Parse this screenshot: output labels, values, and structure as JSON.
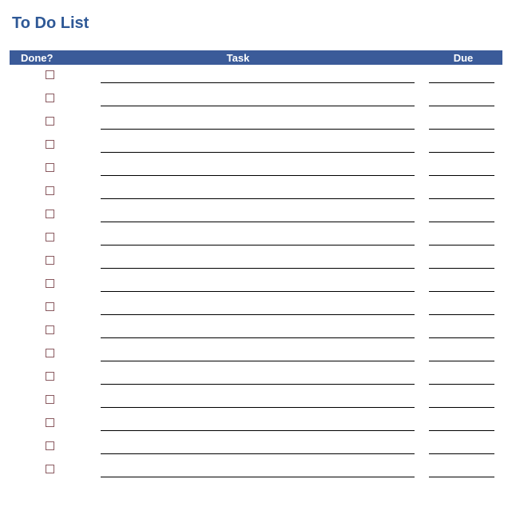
{
  "title": "To Do List",
  "columns": {
    "done": "Done?",
    "task": "Task",
    "due": "Due"
  },
  "rows": [
    {
      "done": false,
      "task": "",
      "due": ""
    },
    {
      "done": false,
      "task": "",
      "due": ""
    },
    {
      "done": false,
      "task": "",
      "due": ""
    },
    {
      "done": false,
      "task": "",
      "due": ""
    },
    {
      "done": false,
      "task": "",
      "due": ""
    },
    {
      "done": false,
      "task": "",
      "due": ""
    },
    {
      "done": false,
      "task": "",
      "due": ""
    },
    {
      "done": false,
      "task": "",
      "due": ""
    },
    {
      "done": false,
      "task": "",
      "due": ""
    },
    {
      "done": false,
      "task": "",
      "due": ""
    },
    {
      "done": false,
      "task": "",
      "due": ""
    },
    {
      "done": false,
      "task": "",
      "due": ""
    },
    {
      "done": false,
      "task": "",
      "due": ""
    },
    {
      "done": false,
      "task": "",
      "due": ""
    },
    {
      "done": false,
      "task": "",
      "due": ""
    },
    {
      "done": false,
      "task": "",
      "due": ""
    },
    {
      "done": false,
      "task": "",
      "due": ""
    },
    {
      "done": false,
      "task": "",
      "due": ""
    }
  ]
}
